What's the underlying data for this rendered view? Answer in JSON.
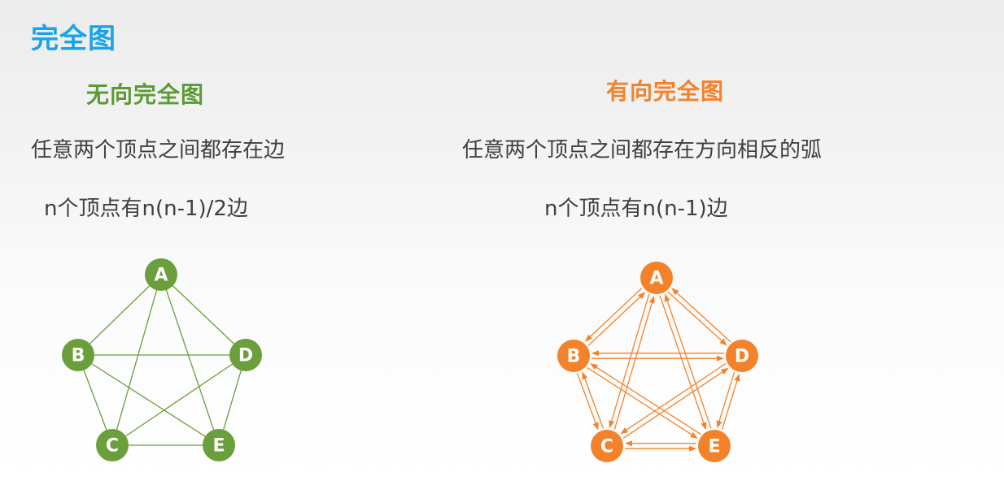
{
  "title": "完全图",
  "undirected": {
    "heading": "无向完全图",
    "description": "任意两个顶点之间都存在边",
    "edge_count": "n个顶点有n(n-1)/2边",
    "color": "#6a9f3c",
    "nodes": [
      "A",
      "B",
      "C",
      "D",
      "E"
    ]
  },
  "directed": {
    "heading": "有向完全图",
    "description": "任意两个顶点之间都存在方向相反的弧",
    "edge_count": "n个顶点有n(n-1)边",
    "color": "#f4822a",
    "nodes": [
      "A",
      "B",
      "C",
      "D",
      "E"
    ]
  }
}
